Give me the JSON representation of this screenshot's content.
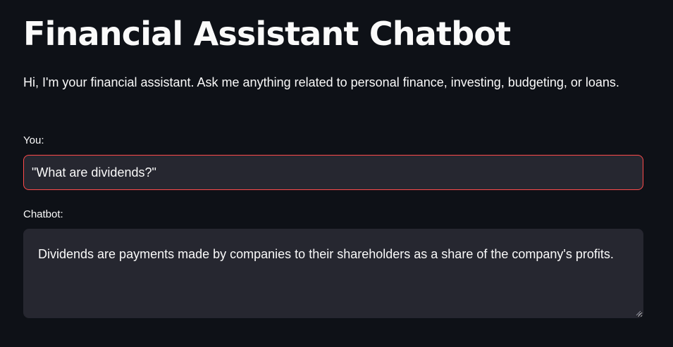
{
  "header": {
    "title": "Financial Assistant Chatbot"
  },
  "intro": {
    "text": "Hi, I'm your financial assistant. Ask me anything related to personal finance, investing, budgeting, or loans."
  },
  "user_input": {
    "label": "You:",
    "value": "\"What are dividends?\""
  },
  "chatbot": {
    "label": "Chatbot:",
    "response": "Dividends are payments made by companies to their shareholders as a share of the company's profits."
  },
  "colors": {
    "background": "#0e1117",
    "input_background": "#262730",
    "focus_border": "#ff4b4b",
    "text": "#fafafa"
  }
}
